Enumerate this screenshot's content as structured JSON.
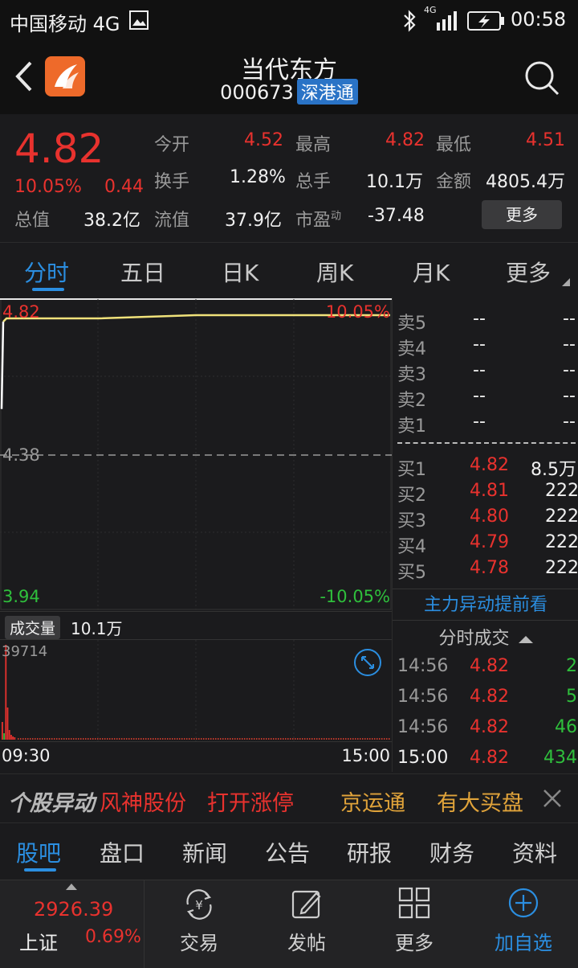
{
  "status_bar": {
    "carrier": "中国移动 4G",
    "network": "4G",
    "time": "00:58"
  },
  "header": {
    "stock_name": "当代东方",
    "code": "000673",
    "badge": "深港通"
  },
  "quote": {
    "price": "4.82",
    "change_pct": "10.05%",
    "change": "0.44",
    "total_value_label": "总值",
    "total_value": "38.2亿",
    "open_label": "今开",
    "open": "4.52",
    "turnover_label": "换手",
    "turnover": "1.28%",
    "float_value_label": "流值",
    "float_value": "37.9亿",
    "high_label": "最高",
    "high": "4.82",
    "total_hands_label": "总手",
    "total_hands": "10.1万",
    "pe_label": "市盈",
    "pe_sup": "动",
    "pe": "-37.48",
    "low_label": "最低",
    "low": "4.51",
    "amount_label": "金额",
    "amount": "4805.4万",
    "more_label": "更多"
  },
  "tabs": [
    "分时",
    "五日",
    "日K",
    "周K",
    "月K",
    "更多"
  ],
  "chart": {
    "top_price": "4.82",
    "top_pct": "10.05%",
    "mid_price": "4.38",
    "bottom_price": "3.94",
    "bottom_pct": "-10.05%",
    "volume_label": "成交量",
    "volume_value": "10.1万",
    "volume_max": "39714",
    "time_start": "09:30",
    "time_end": "15:00"
  },
  "chart_data": {
    "type": "line",
    "ylim": [
      3.94,
      4.82
    ],
    "prev_close": 4.38,
    "price_series": [
      {
        "t": "09:30",
        "v": 4.52
      },
      {
        "t": "09:31",
        "v": 4.79
      },
      {
        "t": "09:33",
        "v": 4.8
      },
      {
        "t": "10:30",
        "v": 4.8
      },
      {
        "t": "13:00",
        "v": 4.81
      },
      {
        "t": "15:00",
        "v": 4.81
      }
    ],
    "x_ticks": [
      "09:30",
      "15:00"
    ],
    "volume_max": 39714
  },
  "order_book": {
    "sell": [
      {
        "label": "卖5",
        "price": "--",
        "vol": "--"
      },
      {
        "label": "卖4",
        "price": "--",
        "vol": "--"
      },
      {
        "label": "卖3",
        "price": "--",
        "vol": "--"
      },
      {
        "label": "卖2",
        "price": "--",
        "vol": "--"
      },
      {
        "label": "卖1",
        "price": "--",
        "vol": "--"
      }
    ],
    "buy": [
      {
        "label": "买1",
        "price": "4.82",
        "vol": "8.5万"
      },
      {
        "label": "买2",
        "price": "4.81",
        "vol": "222"
      },
      {
        "label": "买3",
        "price": "4.80",
        "vol": "222"
      },
      {
        "label": "买4",
        "price": "4.79",
        "vol": "222"
      },
      {
        "label": "买5",
        "price": "4.78",
        "vol": "222"
      }
    ],
    "promo": "主力异动提前看",
    "trades_title": "分时成交",
    "trades": [
      {
        "time": "14:56",
        "price": "4.82",
        "vol": "2"
      },
      {
        "time": "14:56",
        "price": "4.82",
        "vol": "5"
      },
      {
        "time": "14:56",
        "price": "4.82",
        "vol": "46"
      },
      {
        "time": "15:00",
        "price": "4.82",
        "vol": "434"
      }
    ]
  },
  "ticker": {
    "label": "个股异动",
    "item1": "风神股份",
    "item2": "打开涨停",
    "item3": "京运通",
    "item4": "有大买盘"
  },
  "sub_tabs": [
    "股吧",
    "盘口",
    "新闻",
    "公告",
    "研报",
    "财务",
    "资料"
  ],
  "bottom_nav": {
    "index_value": "2926.39",
    "index_name": "上证",
    "index_pct": "0.69%",
    "items": [
      "交易",
      "发帖",
      "更多",
      "加自选"
    ]
  },
  "colors": {
    "up": "#e8322e",
    "down": "#2fbf3c",
    "accent": "#2b8ee0",
    "line": "#f0e27a"
  }
}
